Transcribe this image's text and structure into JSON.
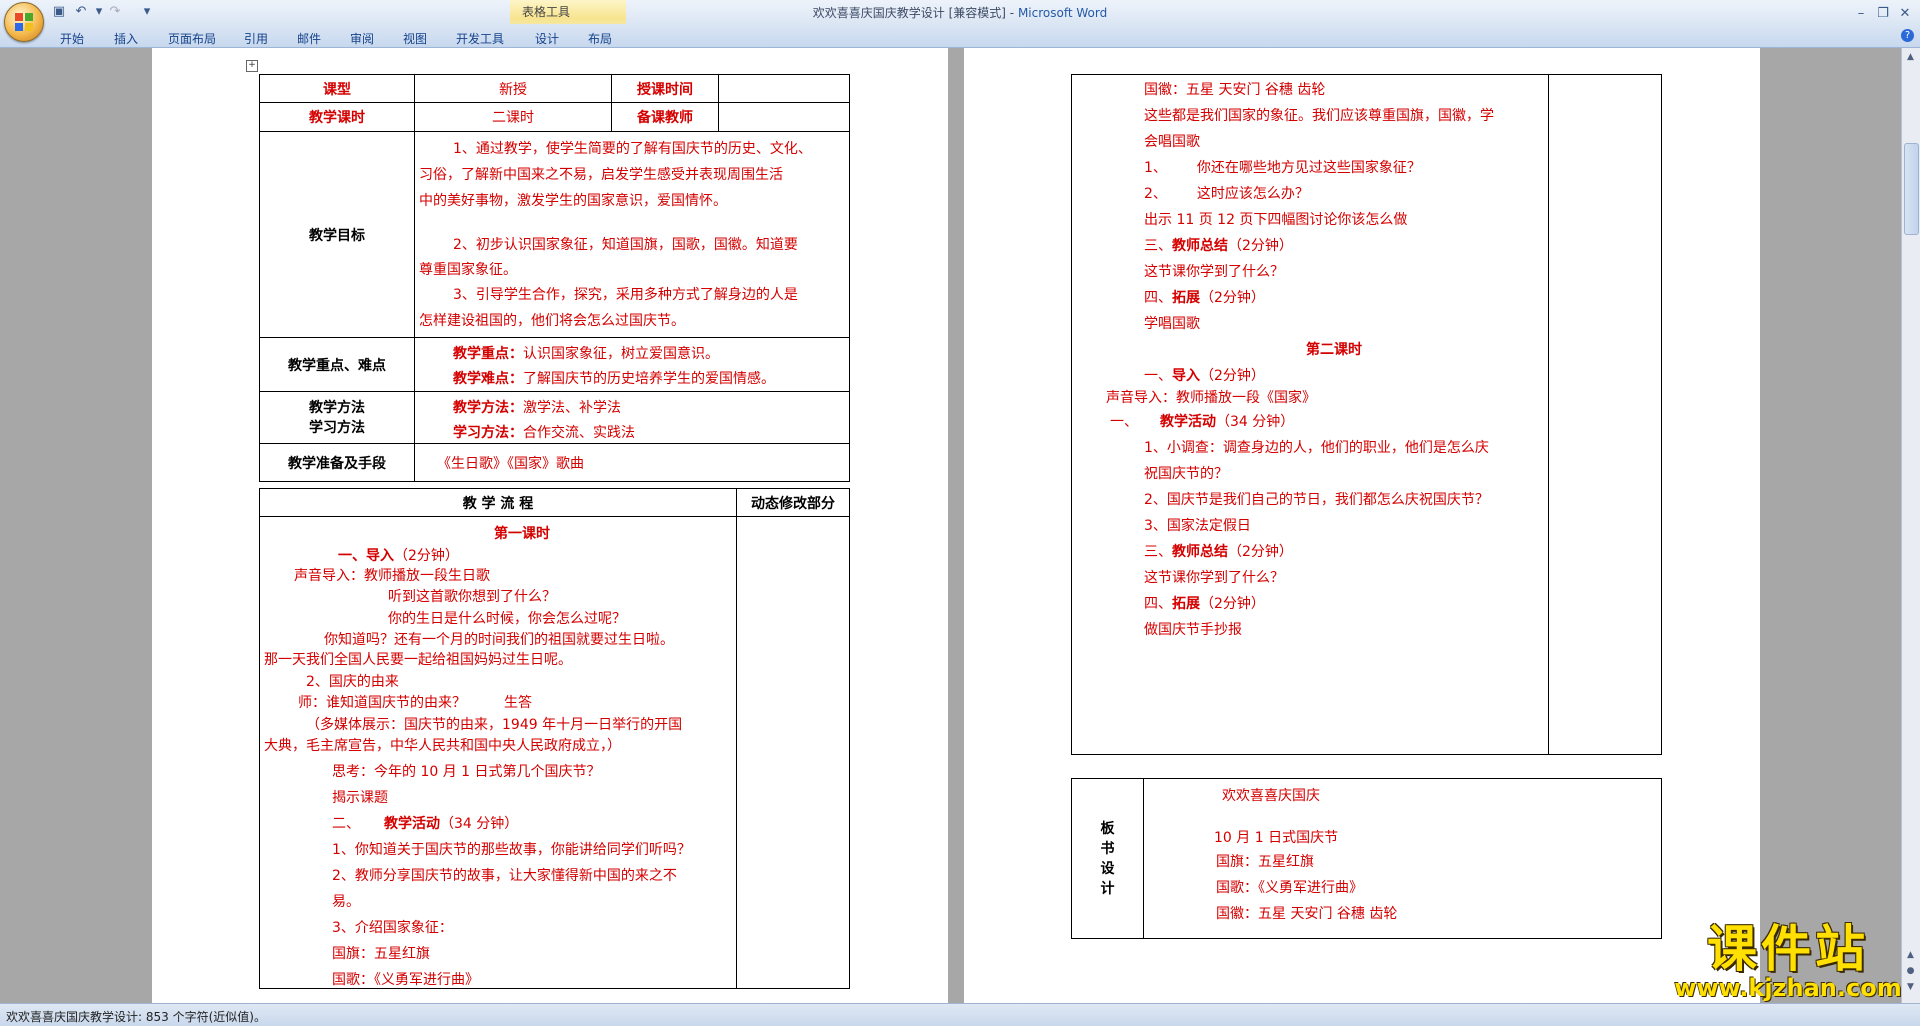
{
  "window": {
    "title": "欢欢喜喜庆国庆教学设计 [兼容模式]",
    "app_name": "Microsoft Word",
    "separator": " - ",
    "context_group": "表格工具"
  },
  "ribbon": {
    "tabs": [
      "开始",
      "插入",
      "页面布局",
      "引用",
      "邮件",
      "审阅",
      "视图",
      "开发工具",
      "设计",
      "布局"
    ]
  },
  "colors": {
    "doc_text": "#d40000",
    "ribbon_bg": "#dbe6f4",
    "workspace_bg": "#a7a7a7"
  },
  "status": {
    "text": "欢欢喜喜庆国庆教学设计: 853 个字符(近似值)。"
  },
  "watermark": {
    "cn": "课件站",
    "url": "www.kjzhan.com"
  },
  "page1": {
    "r1": {
      "label": "课型",
      "value": "新授",
      "label2": "授课时间",
      "value2": ""
    },
    "r2": {
      "label": "教学课时",
      "value": "二课时",
      "label2": "备课教师",
      "value2": ""
    },
    "objectives": {
      "label": "教学目标",
      "lines": [
        "1、通过教学，使学生简要的了解有国庆节的历史、文化、",
        "习俗，了解新中国来之不易，启发学生感受并表现周围生活",
        "中的美好事物，激发学生的国家意识，爱国情怀。",
        "2、初步认识国家象征，知道国旗，国歌，国徽。知道要",
        "尊重国家象征。",
        "3、引导学生合作，探究，采用多种方式了解身边的人是",
        "怎样建设祖国的，他们将会怎么过国庆节。"
      ]
    },
    "keypoints": {
      "label": "教学重点、难点",
      "zd_label": "教学重点：",
      "zd_text": "认识国家象征，树立爱国意识。",
      "nd_label": "教学难点：",
      "nd_text": "了解国庆节的历史培养学生的爱国情感。"
    },
    "methods": {
      "label1": "教学方法",
      "label2": "学习方法",
      "jf_label": "教学方法：",
      "jf_text": "激学法、补学法",
      "xf_label": "学习方法：",
      "xf_text": "合作交流、实践法"
    },
    "prep": {
      "label": "教学准备及手段",
      "text": "《生日歌》《国家》歌曲"
    },
    "flow": {
      "header": "教 学 流 程",
      "header2": "动态修改部分"
    },
    "lesson1": {
      "title": "第一课时",
      "l01": "一、",
      "l01b": "导入",
      "l01c": "（2分钟）",
      "l02": "声音导入：教师播放一段生日歌",
      "l03": "听到这首歌你想到了什么？",
      "l04": "你的生日是什么时候，你会怎么过呢？",
      "l05": "你知道吗？还有一个月的时间我们的祖国就要过生日啦。",
      "l06": "那一天我们全国人民要一起给祖国妈妈过生日呢。",
      "l07": "2、国庆的由来",
      "l08": "师：谁知道国庆节的由来？",
      "l08b": "生答",
      "l09": "（多媒体展示：国庆节的由来，1949 年十月一日举行的开国",
      "l10": "大典，毛主席宣告，中华人民共和国中央人民政府成立，）",
      "l11": "思考：今年的 10 月 1 日式第几个国庆节？",
      "l12": "揭示课题",
      "l13": "二、",
      "l13b": "教学活动",
      "l13c": "（34 分钟）",
      "l14": "1、你知道关于国庆节的那些故事，你能讲给同学们听吗？",
      "l15": "2、教师分享国庆节的故事，让大家懂得新中国的来之不",
      "l16": "易。",
      "l17": "3、介绍国家象征：",
      "l18": "国旗：五星红旗",
      "l19": "国歌：《义勇军进行曲》"
    }
  },
  "page2": {
    "p01": "国徽：五星 天安门 谷穗 齿轮",
    "p02": "这些都是我们国家的象征。我们应该尊重国旗，国徽，学",
    "p03": "会唱国歌",
    "p04": "1、",
    "p04b": "你还在哪些地方见过这些国家象征？",
    "p05": "2、",
    "p05b": "这时应该怎么办？",
    "p06": "出示 11 页 12 页下四幅图讨论你该怎么做",
    "p07": "三、",
    "p07b": "教师总结",
    "p07c": "（2分钟）",
    "p08": "这节课你学到了什么？",
    "p09": "四、",
    "p09b": "拓展",
    "p09c": "（2分钟）",
    "p10": "学唱国歌",
    "lesson2_title": "第二课时",
    "p11": "一、",
    "p11b": "导入",
    "p11c": "（2分钟）",
    "p12": "声音导入：教师播放一段《国家》",
    "p13": "一、",
    "p13b": "教学活动",
    "p13c": "（34 分钟）",
    "p14": "1、小调查：调查身边的人，他们的职业，他们是怎么庆",
    "p15": "祝国庆节的？",
    "p16": "2、国庆节是我们自己的节日，我们都怎么庆祝国庆节？",
    "p17": "3、国家法定假日",
    "p18": "三、",
    "p18b": "教师总结",
    "p18c": "（2分钟）",
    "p19": "这节课你学到了什么？",
    "p20": "四、",
    "p20b": "拓展",
    "p20c": "（2分钟）",
    "p21": "做国庆节手抄报",
    "board": {
      "label": [
        "板",
        "书",
        "设",
        "计"
      ],
      "title": "欢欢喜喜庆国庆",
      "b1": "10 月 1 日式国庆节",
      "b2": "国旗：五星红旗",
      "b3": "国歌：《义勇军进行曲》",
      "b4": "国徽：五星 天安门 谷穗 齿轮"
    }
  }
}
